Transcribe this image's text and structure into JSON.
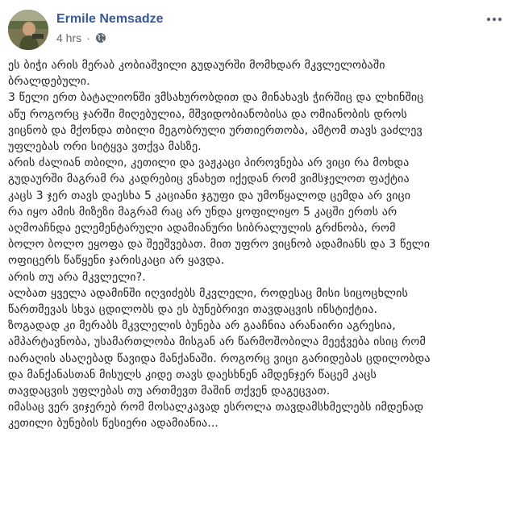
{
  "post": {
    "author": "Ermile Nemsadze",
    "timestamp": "4 hrs",
    "separator": "·",
    "privacy_icon": "globe-icon",
    "options_icon": "more-horizontal-icon",
    "avatar_icon": "profile-photo",
    "lines": [
      "ეს ბიჭი არის მერაბ კობიაშვილი გუდაურში მომხდარ მკვლელობაში",
      "ბრალდებული.",
      "3 წელი ერთ ბატალიონში ვმსახურობდით და მინახავს ჭირშიც და ლხინშიც",
      "აწუ როგორც ჯარში მიღებულია, მშვიდობიანობისა და ომიანობის დროს",
      "ვიცნობ და მქონდა თბილი მეგობრული ურთიერთობა, ამტომ თავს ვაძლევ",
      "უფლებას ორი სიტყვა ვთქვა მასზე.",
      "არის ძალიან თბილი, კეთილი და ვაჟკაცი პიროვნება არ ვიცი რა მოხდა",
      "გუდაურში მაგრამ რა კადრებიც ვნახეთ იქედან რომ ვიმსჯელოთ ფაქტია",
      "კაცს 3 ჯერ თავს დაესხა 5 კაციანი ჯგუფი და უმოწყალოდ ცემდა არ ვიცი",
      "რა იყო ამის მიზეზი მაგრამ რაც არ უნდა ყოფილიყო 5 კაცში ერთს არ",
      "აღმოაჩნდა ელემენტარული ადამიანური სიბრალულის გრძნობა, რომ",
      "ბოლო ბოლო ეყოფა და შეეშვებათ. მით უფრო ვიცნობ ადამიანს და 3 წელი",
      "ოფიცერს წაწყენი ჯარისკაცი არ ყავდა.",
      "არის თუ არა მკვლელი?.",
      "ალბათ ყველა ადამინში იღვიძებს მკვლელი, როდესაც მისი სიცოცხლის",
      "წართმევას სხვა ცდილობს და ეს ბუნებრივი თავდაცვის ინსტიქტია.",
      "ზოგადად კი მერაბს მკვლელის ბუნება არ გააჩნია არანაირი აგრესია,",
      "ამპარტავნობა, უსამართლობა მისგან არ წარმოშობილა მეეჭვება ისიც რომ",
      "იარაღის ასაღებად წავიდა მანქანაში. როგორც ვიცი გარიდებას ცდილობდა",
      "და მანქანასთან მისულს კიდე თავს დაესხნენ ამდენჯერ წაცემ კაცს",
      "თავდაცვის უფლებას თუ ართმევთ მაშინ თქვენ დაგეცვათ.",
      "იმასაც ვერ ვიჯერებ რომ მოსალკავად ესროლა თავდამსხმელებს იმდენად",
      "კეთილი ბუნების წესიერი ადამიანია..."
    ]
  }
}
